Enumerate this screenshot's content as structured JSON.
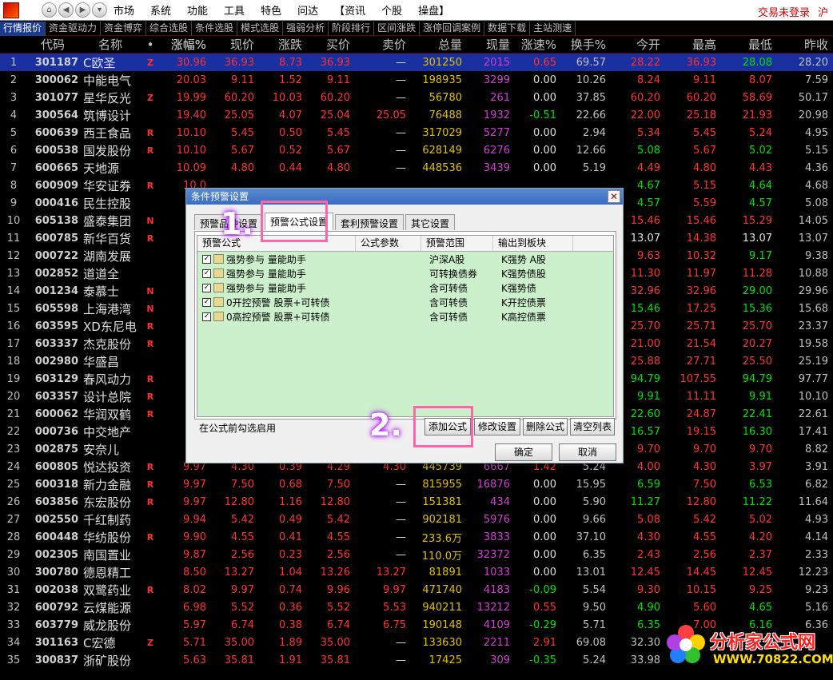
{
  "menubar": {
    "items": [
      "市场",
      "系统",
      "功能",
      "工具",
      "特色",
      "问达",
      "【资讯",
      "个股",
      "操盘】"
    ],
    "login": "交易未登录",
    "region": "沪"
  },
  "tabs": [
    "行情报价",
    "资金驱动力",
    "资金博弈",
    "综合选股",
    "条件选股",
    "模式选股",
    "强弱分析",
    "阶段排行",
    "区间涨跌",
    "涨停回调案例",
    "数据下载",
    "主站测速"
  ],
  "table": {
    "headers": [
      "代码",
      "名称",
      "•",
      "涨幅%",
      "现价",
      "涨跌",
      "买价",
      "卖价",
      "总量",
      "现量",
      "涨速%",
      "换手%",
      "今开",
      "最高",
      "最低",
      "昨收"
    ],
    "rows": [
      {
        "i": "1",
        "code": "301187",
        "name": "C欧圣",
        "flag": "Z",
        "pct": "30.96",
        "price": "36.93",
        "chg": "8.73",
        "bid": "36.93",
        "ask": "—",
        "vol": "301250",
        "cur": "2015",
        "spd": "0.65",
        "turn": "69.57",
        "open": "28.22",
        "high": "36.93",
        "low": "28.08",
        "close": "28.20"
      },
      {
        "i": "2",
        "code": "300062",
        "name": "中能电气",
        "flag": "",
        "pct": "20.03",
        "price": "9.11",
        "chg": "1.52",
        "bid": "9.11",
        "ask": "—",
        "vol": "198935",
        "cur": "3299",
        "spd": "0.00",
        "turn": "10.26",
        "open": "8.24",
        "high": "9.11",
        "low": "8.07",
        "close": "7.59"
      },
      {
        "i": "3",
        "code": "301077",
        "name": "星华反光",
        "flag": "Z",
        "pct": "19.99",
        "price": "60.20",
        "chg": "10.03",
        "bid": "60.20",
        "ask": "—",
        "vol": "56780",
        "cur": "261",
        "spd": "0.00",
        "turn": "37.85",
        "open": "60.20",
        "high": "60.20",
        "low": "58.69",
        "close": "50.17"
      },
      {
        "i": "4",
        "code": "300564",
        "name": "筑博设计",
        "flag": "",
        "pct": "19.40",
        "price": "25.05",
        "chg": "4.07",
        "bid": "25.04",
        "ask": "25.05",
        "vol": "76488",
        "cur": "1932",
        "spd": "-0.51",
        "turn": "22.66",
        "open": "22.00",
        "high": "25.18",
        "low": "21.93",
        "close": "20.98"
      },
      {
        "i": "5",
        "code": "600639",
        "name": "西王食品",
        "flag": "R",
        "pct": "10.10",
        "price": "5.45",
        "chg": "0.50",
        "bid": "5.45",
        "ask": "—",
        "vol": "317029",
        "cur": "5277",
        "spd": "0.00",
        "turn": "2.94",
        "open": "5.34",
        "high": "5.45",
        "low": "5.24",
        "close": "4.95"
      },
      {
        "i": "6",
        "code": "600538",
        "name": "国发股份",
        "flag": "R",
        "pct": "10.10",
        "price": "5.67",
        "chg": "0.52",
        "bid": "5.67",
        "ask": "—",
        "vol": "628149",
        "cur": "6276",
        "spd": "0.00",
        "turn": "12.66",
        "open": "5.08",
        "high": "5.67",
        "low": "5.02",
        "close": "5.15"
      },
      {
        "i": "7",
        "code": "600665",
        "name": "天地源",
        "flag": "",
        "pct": "10.09",
        "price": "4.80",
        "chg": "0.44",
        "bid": "4.80",
        "ask": "—",
        "vol": "448536",
        "cur": "3439",
        "spd": "0.00",
        "turn": "5.19",
        "open": "4.49",
        "high": "4.80",
        "low": "4.43",
        "close": "4.36"
      },
      {
        "i": "8",
        "code": "600909",
        "name": "华安证券",
        "flag": "R",
        "pct": "10.0",
        "price": "",
        "chg": "",
        "bid": "",
        "ask": "",
        "vol": "",
        "cur": "",
        "spd": "",
        "turn": "",
        "open": "4.67",
        "high": "5.15",
        "low": "4.64",
        "close": "4.68"
      },
      {
        "i": "9",
        "code": "000416",
        "name": "民生控股",
        "flag": "",
        "pct": "10.",
        "price": "",
        "chg": "",
        "bid": "",
        "ask": "",
        "vol": "",
        "cur": "",
        "spd": "",
        "turn": "",
        "open": "4.57",
        "high": "5.59",
        "low": "4.57",
        "close": "5.08"
      },
      {
        "i": "10",
        "code": "605138",
        "name": "盛泰集团",
        "flag": "N",
        "pct": "10.",
        "price": "",
        "chg": "",
        "bid": "",
        "ask": "",
        "vol": "",
        "cur": "",
        "spd": "",
        "turn": "",
        "open": "15.46",
        "high": "15.46",
        "low": "15.29",
        "close": "14.05"
      },
      {
        "i": "11",
        "code": "600785",
        "name": "新华百货",
        "flag": "R",
        "pct": "10.",
        "price": "",
        "chg": "",
        "bid": "",
        "ask": "",
        "vol": "",
        "cur": "",
        "spd": "",
        "turn": "",
        "open": "13.07",
        "high": "14.38",
        "low": "13.07",
        "close": "13.07"
      },
      {
        "i": "12",
        "code": "000722",
        "name": "湖南发展",
        "flag": "",
        "pct": "10.",
        "price": "",
        "chg": "",
        "bid": "",
        "ask": "",
        "vol": "",
        "cur": "",
        "spd": "",
        "turn": "",
        "open": "9.63",
        "high": "10.32",
        "low": "9.17",
        "close": "9.38"
      },
      {
        "i": "13",
        "code": "002852",
        "name": "道道全",
        "flag": "",
        "pct": "10.",
        "price": "",
        "chg": "",
        "bid": "",
        "ask": "",
        "vol": "",
        "cur": "",
        "spd": "",
        "turn": "",
        "open": "11.30",
        "high": "11.97",
        "low": "11.28",
        "close": "10.88"
      },
      {
        "i": "14",
        "code": "001234",
        "name": "泰慕士",
        "flag": "N",
        "pct": "10.",
        "price": "",
        "chg": "",
        "bid": "",
        "ask": "",
        "vol": "",
        "cur": "",
        "spd": "",
        "turn": "",
        "open": "32.96",
        "high": "32.96",
        "low": "29.00",
        "close": "29.96"
      },
      {
        "i": "15",
        "code": "605598",
        "name": "上海港湾",
        "flag": "N",
        "pct": "10.",
        "price": "",
        "chg": "",
        "bid": "",
        "ask": "",
        "vol": "",
        "cur": "",
        "spd": "",
        "turn": "",
        "open": "15.46",
        "high": "17.25",
        "low": "15.36",
        "close": "15.68"
      },
      {
        "i": "16",
        "code": "603595",
        "name": "XD东尼电",
        "flag": "R",
        "pct": "10.",
        "price": "",
        "chg": "",
        "bid": "",
        "ask": "",
        "vol": "",
        "cur": "",
        "spd": "",
        "turn": "",
        "open": "25.70",
        "high": "25.71",
        "low": "25.70",
        "close": "23.37"
      },
      {
        "i": "17",
        "code": "603337",
        "name": "杰克股份",
        "flag": "R",
        "pct": "10.",
        "price": "",
        "chg": "",
        "bid": "",
        "ask": "",
        "vol": "",
        "cur": "",
        "spd": "",
        "turn": "",
        "open": "21.00",
        "high": "21.54",
        "low": "20.27",
        "close": "19.58"
      },
      {
        "i": "18",
        "code": "002980",
        "name": "华盛昌",
        "flag": "",
        "pct": "10.",
        "price": "",
        "chg": "",
        "bid": "",
        "ask": "",
        "vol": "",
        "cur": "",
        "spd": "",
        "turn": "",
        "open": "25.88",
        "high": "27.71",
        "low": "25.50",
        "close": "25.19"
      },
      {
        "i": "19",
        "code": "603129",
        "name": "春风动力",
        "flag": "R",
        "pct": "10.",
        "price": "",
        "chg": "",
        "bid": "",
        "ask": "",
        "vol": "",
        "cur": "",
        "spd": "",
        "turn": "",
        "open": "94.79",
        "high": "107.55",
        "low": "94.79",
        "close": "97.77"
      },
      {
        "i": "20",
        "code": "603357",
        "name": "设计总院",
        "flag": "R",
        "pct": "10.",
        "price": "",
        "chg": "",
        "bid": "",
        "ask": "",
        "vol": "",
        "cur": "",
        "spd": "",
        "turn": "",
        "open": "9.91",
        "high": "11.11",
        "low": "9.91",
        "close": "10.10"
      },
      {
        "i": "21",
        "code": "600062",
        "name": "华润双鹤",
        "flag": "R",
        "pct": "10.",
        "price": "",
        "chg": "",
        "bid": "",
        "ask": "",
        "vol": "",
        "cur": "",
        "spd": "",
        "turn": "",
        "open": "22.60",
        "high": "24.87",
        "low": "22.41",
        "close": "22.61"
      },
      {
        "i": "22",
        "code": "000736",
        "name": "中交地产",
        "flag": "",
        "pct": "9.",
        "price": "",
        "chg": "",
        "bid": "",
        "ask": "",
        "vol": "",
        "cur": "",
        "spd": "",
        "turn": "",
        "open": "16.57",
        "high": "19.15",
        "low": "16.30",
        "close": "17.41"
      },
      {
        "i": "23",
        "code": "002875",
        "name": "安奈儿",
        "flag": "",
        "pct": "9.",
        "price": "",
        "chg": "",
        "bid": "",
        "ask": "",
        "vol": "",
        "cur": "",
        "spd": "",
        "turn": "",
        "open": "9.70",
        "high": "9.70",
        "low": "9.70",
        "close": "8.82"
      },
      {
        "i": "24",
        "code": "600805",
        "name": "悦达投资",
        "flag": "R",
        "pct": "9.97",
        "price": "4.30",
        "chg": "0.39",
        "bid": "4.29",
        "ask": "4.30",
        "vol": "445739",
        "cur": "6667",
        "spd": "1.42",
        "turn": "5.24",
        "open": "4.00",
        "high": "4.30",
        "low": "3.97",
        "close": "3.91"
      },
      {
        "i": "25",
        "code": "600318",
        "name": "新力金融",
        "flag": "R",
        "pct": "9.97",
        "price": "7.50",
        "chg": "0.68",
        "bid": "7.50",
        "ask": "—",
        "vol": "815955",
        "cur": "16876",
        "spd": "0.00",
        "turn": "15.95",
        "open": "6.59",
        "high": "7.50",
        "low": "6.53",
        "close": "6.82"
      },
      {
        "i": "26",
        "code": "603856",
        "name": "东宏股份",
        "flag": "R",
        "pct": "9.97",
        "price": "12.80",
        "chg": "1.16",
        "bid": "12.80",
        "ask": "—",
        "vol": "151381",
        "cur": "434",
        "spd": "0.00",
        "turn": "5.90",
        "open": "11.27",
        "high": "12.80",
        "low": "11.22",
        "close": "11.64"
      },
      {
        "i": "27",
        "code": "002550",
        "name": "千红制药",
        "flag": "",
        "pct": "9.94",
        "price": "5.42",
        "chg": "0.49",
        "bid": "5.42",
        "ask": "—",
        "vol": "902181",
        "cur": "5976",
        "spd": "0.00",
        "turn": "9.66",
        "open": "5.08",
        "high": "5.42",
        "low": "5.02",
        "close": "4.93"
      },
      {
        "i": "28",
        "code": "600448",
        "name": "华纺股份",
        "flag": "R",
        "pct": "9.90",
        "price": "4.55",
        "chg": "0.41",
        "bid": "4.55",
        "ask": "—",
        "vol": "233.6万",
        "cur": "3833",
        "spd": "0.00",
        "turn": "37.10",
        "open": "4.30",
        "high": "4.55",
        "low": "4.20",
        "close": "4.14"
      },
      {
        "i": "29",
        "code": "002305",
        "name": "南国置业",
        "flag": "",
        "pct": "9.87",
        "price": "2.56",
        "chg": "0.23",
        "bid": "2.56",
        "ask": "—",
        "vol": "110.0万",
        "cur": "32372",
        "spd": "0.00",
        "turn": "6.35",
        "open": "2.43",
        "high": "2.56",
        "low": "2.37",
        "close": "2.33"
      },
      {
        "i": "30",
        "code": "300780",
        "name": "德恩精工",
        "flag": "",
        "pct": "8.50",
        "price": "13.27",
        "chg": "1.04",
        "bid": "13.26",
        "ask": "13.27",
        "vol": "81891",
        "cur": "1033",
        "spd": "0.00",
        "turn": "13.01",
        "open": "12.45",
        "high": "14.45",
        "low": "12.45",
        "close": "12.23"
      },
      {
        "i": "31",
        "code": "002038",
        "name": "双鹭药业",
        "flag": "R",
        "pct": "8.02",
        "price": "9.97",
        "chg": "0.74",
        "bid": "9.96",
        "ask": "9.97",
        "vol": "471740",
        "cur": "4183",
        "spd": "-0.09",
        "turn": "5.54",
        "open": "9.30",
        "high": "10.15",
        "low": "9.25",
        "close": "9.23"
      },
      {
        "i": "32",
        "code": "600792",
        "name": "云煤能源",
        "flag": "",
        "pct": "6.98",
        "price": "5.52",
        "chg": "0.36",
        "bid": "5.52",
        "ask": "5.53",
        "vol": "940211",
        "cur": "13212",
        "spd": "0.55",
        "turn": "9.50",
        "open": "4.90",
        "high": "5.60",
        "low": "4.65",
        "close": "5.16"
      },
      {
        "i": "33",
        "code": "603779",
        "name": "威龙股份",
        "flag": "",
        "pct": "5.97",
        "price": "6.74",
        "chg": "0.38",
        "bid": "6.74",
        "ask": "6.75",
        "vol": "190148",
        "cur": "4109",
        "spd": "-0.29",
        "turn": "5.71",
        "open": "6.35",
        "high": "7.00",
        "low": "6.16",
        "close": "6.36"
      },
      {
        "i": "34",
        "code": "301163",
        "name": "C宏德",
        "flag": "Z",
        "pct": "5.71",
        "price": "35.00",
        "chg": "1.89",
        "bid": "35.00",
        "ask": "—",
        "vol": "133630",
        "cur": "2211",
        "spd": "2.91",
        "turn": "69.08",
        "open": "32.30",
        "high": "",
        "low": "",
        "close": ""
      },
      {
        "i": "35",
        "code": "300837",
        "name": "浙矿股份",
        "flag": "",
        "pct": "5.63",
        "price": "35.81",
        "chg": "1.91",
        "bid": "35.81",
        "ask": "—",
        "vol": "17425",
        "cur": "309",
        "spd": "-0.35",
        "turn": "5.24",
        "open": "33.98",
        "high": "",
        "low": "",
        "close": ""
      }
    ]
  },
  "dialog": {
    "title": "条件预警设置",
    "tabs": [
      "预警品种设置",
      "预警公式设置",
      "套利预警设置",
      "其它设置"
    ],
    "columns": [
      "预警公式",
      "公式参数",
      "预警范围",
      "输出到板块"
    ],
    "items": [
      {
        "formula": "强势参与 量能助手",
        "param": "",
        "range": "沪深A股",
        "output": "K强势 A股"
      },
      {
        "formula": "强势参与 量能助手",
        "param": "",
        "range": "可转换债券",
        "output": "K强势债股"
      },
      {
        "formula": "强势参与 量能助手",
        "param": "",
        "range": "含可转债",
        "output": "K强势债"
      },
      {
        "formula": "0开控预警 股票+可转债",
        "param": "",
        "range": "含可转债",
        "output": "K开控债票"
      },
      {
        "formula": "0高控预警 股票+可转债",
        "param": "",
        "range": "含可转债",
        "output": "K高控债票"
      }
    ],
    "hint": "在公式前勾选启用",
    "buttons": {
      "add": "添加公式",
      "modify": "修改设置",
      "delete": "删除公式",
      "clear": "清空列表",
      "ok": "确定",
      "cancel": "取消"
    }
  },
  "annotations": {
    "step1": "1.",
    "step2": "2."
  },
  "watermark": {
    "title": "分析家公式网",
    "url": "WWW.70822.COM"
  }
}
